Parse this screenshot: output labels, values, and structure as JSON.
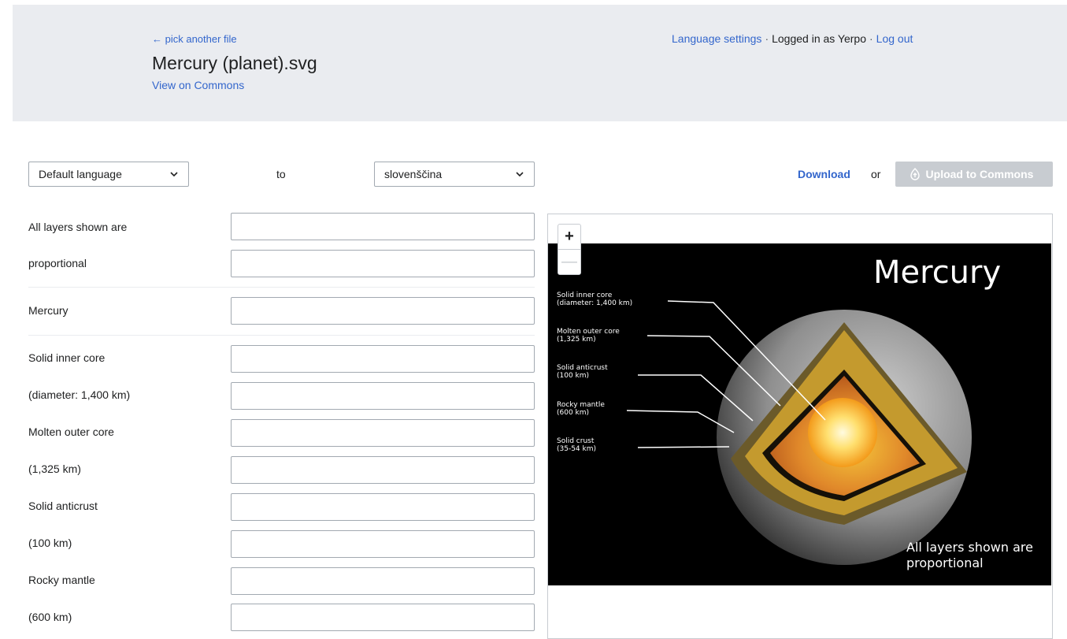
{
  "header": {
    "back_link": "← pick another file",
    "file_title": "Mercury (planet).svg",
    "view_link": "View on Commons",
    "language_settings": "Language settings",
    "separator": "·",
    "logged_in": "Logged in as Yerpo",
    "log_out": "Log out"
  },
  "toolbar": {
    "source_language": "Default language",
    "to_label": "to",
    "target_language": "slovenščina",
    "download_label": "Download",
    "or_label": "or",
    "upload_label": "Upload to Commons"
  },
  "rows": [
    {
      "label": "All layers shown are",
      "value": ""
    },
    {
      "label": "proportional",
      "value": ""
    },
    {
      "label": "Mercury",
      "value": ""
    },
    {
      "label": "Solid inner core",
      "value": ""
    },
    {
      "label": "(diameter: 1,400 km)",
      "value": ""
    },
    {
      "label": "Molten outer core",
      "value": ""
    },
    {
      "label": "(1,325 km)",
      "value": ""
    },
    {
      "label": "Solid anticrust",
      "value": ""
    },
    {
      "label": "(100 km)",
      "value": ""
    },
    {
      "label": "Rocky mantle",
      "value": ""
    },
    {
      "label": "(600 km)",
      "value": ""
    }
  ],
  "preview": {
    "zoom_in": "+",
    "zoom_out": "—",
    "planet_title": "Mercury",
    "layers": [
      {
        "line1": "Solid inner core",
        "line2": "(diameter: 1,400 km)"
      },
      {
        "line1": "Molten outer core",
        "line2": "(1,325 km)"
      },
      {
        "line1": "Solid anticrust",
        "line2": "(100 km)"
      },
      {
        "line1": "Rocky mantle",
        "line2": "(600 km)"
      },
      {
        "line1": "Solid crust",
        "line2": "(35-54 km)"
      }
    ],
    "note_line1": "All layers shown are",
    "note_line2": "proportional"
  },
  "colors": {
    "link": "#3366cc",
    "header_bg": "#eaecf0",
    "upload_disabled": "#c8ccd1"
  }
}
